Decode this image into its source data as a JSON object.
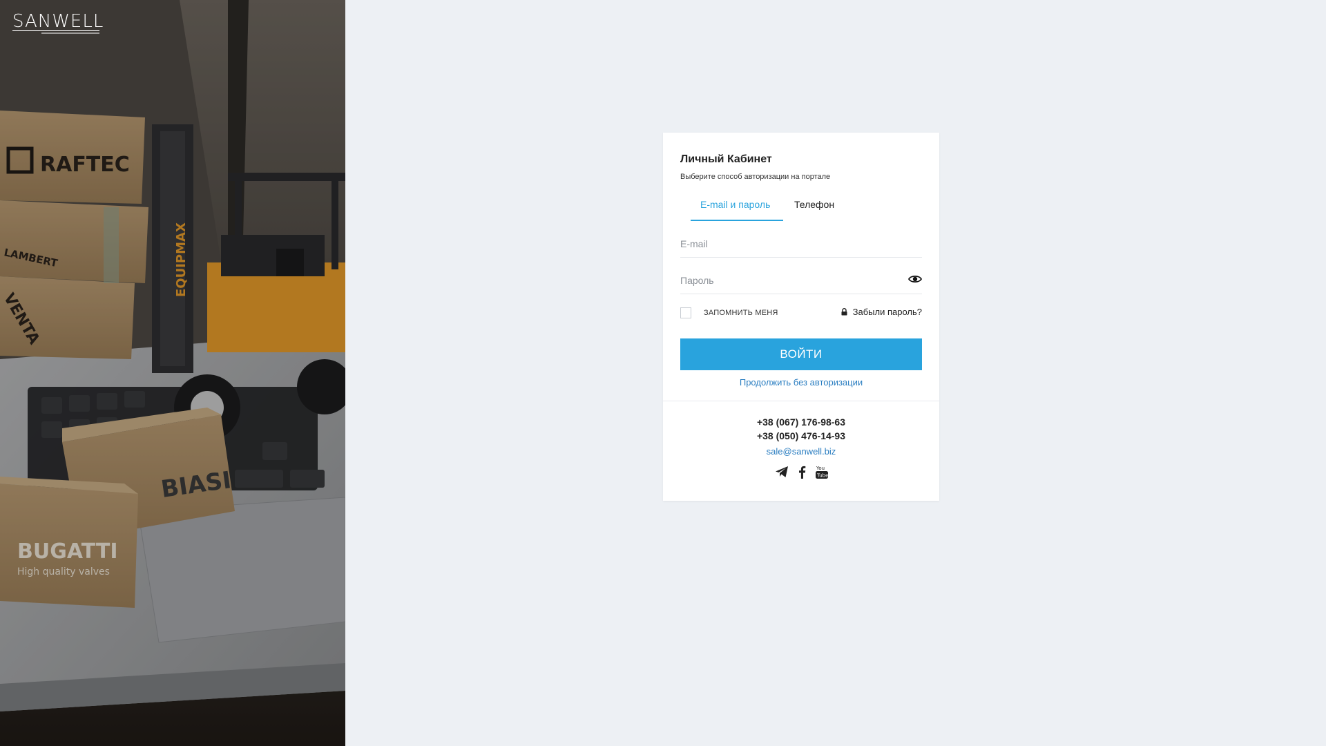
{
  "brand": {
    "logo_text": "SANWELL"
  },
  "hero": {
    "box_labels": [
      "RAFTEC",
      "LAMBERT",
      "VENTA",
      "BIASI",
      "BUGATTI"
    ],
    "bugatti_tagline": "High quality valves",
    "forklift_label": "EQUIPMAX"
  },
  "card": {
    "title": "Личный Кабинет",
    "subtitle": "Выберите способ авторизации на портале",
    "tabs": [
      {
        "label": "E-mail и пароль",
        "active": true
      },
      {
        "label": "Телефон",
        "active": false
      }
    ],
    "email": {
      "placeholder": "E-mail",
      "value": ""
    },
    "password": {
      "placeholder": "Пароль",
      "value": ""
    },
    "remember_label": "ЗАПОМНИТЬ МЕНЯ",
    "remember_checked": false,
    "forgot_label": "Забыли пароль?",
    "login_button": "ВОЙТИ",
    "guest_link": "Продолжить без авторизации"
  },
  "contacts": {
    "phones": [
      "+38 (067) 176-98-63",
      "+38 (050) 476-14-93"
    ],
    "email": "sale@sanwell.biz",
    "socials": [
      "telegram-icon",
      "facebook-icon",
      "youtube-icon"
    ]
  },
  "colors": {
    "accent": "#29a3dd",
    "link": "#2b7ec1",
    "page_bg": "#edf0f4",
    "card_bg": "#ffffff"
  }
}
